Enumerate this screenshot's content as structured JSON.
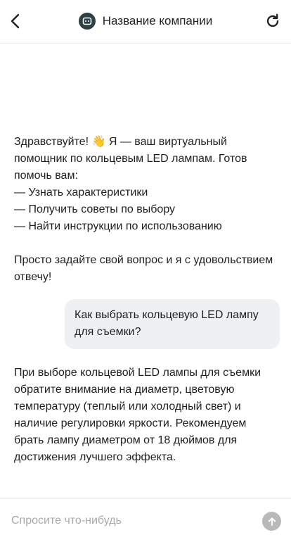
{
  "header": {
    "back_icon": "chevron-left-icon",
    "logo_icon": "bot-icon",
    "title": "Название компании",
    "refresh_icon": "refresh-icon"
  },
  "messages": {
    "greeting": {
      "sender": "bot",
      "line1": "Здравствуйте! 👋 Я — ваш виртуальный помощник по кольцевым LED лампам. Готов помочь вам:",
      "bullets": [
        "— Узнать характеристики",
        "— Получить советы по выбору",
        "— Найти инструкции по использованию"
      ],
      "closing": "Просто задайте свой вопрос и я с удовольствием отвечу!"
    },
    "user_question": {
      "sender": "user",
      "text": "Как выбрать кольцевую LED лампу для съемки?"
    },
    "answer": {
      "sender": "bot",
      "text": "При выборе кольцевой LED лампы для съемки обратите внимание на диаметр, цветовую температуру (теплый или холодный свет) и наличие регулировки яркости. Рекомендуем брать лампу диаметром от 18 дюймов для достижения лучшего эффекта."
    }
  },
  "composer": {
    "placeholder": "Спросите что-нибудь",
    "value": "",
    "send_icon": "arrow-up-icon"
  },
  "colors": {
    "logo_bg": "#2e3f45",
    "user_bubble": "#eef0f2",
    "send_button": "#b9b9b9",
    "placeholder": "#a9a9a9",
    "divider": "#ececec"
  }
}
